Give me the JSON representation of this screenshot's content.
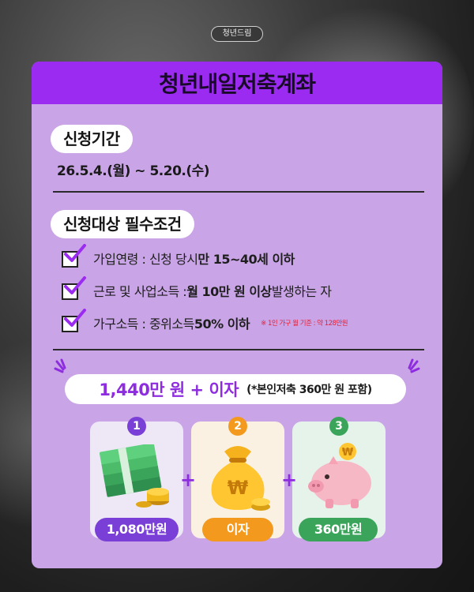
{
  "brand": "청년드림",
  "title": "청년내일저축계좌",
  "period": {
    "heading": "신청기간",
    "value": "26.5.4.(월) ~ 5.20.(수)"
  },
  "requirements": {
    "heading": "신청대상 필수조건",
    "items": [
      {
        "label": "가입연령 : 신청 당시 ",
        "strong": "만 15~40세 이하",
        "tail": ""
      },
      {
        "label": "근로 및 사업소득 : ",
        "strong": "월 10만 원 이상",
        "tail": " 발생하는 자"
      },
      {
        "label": "가구소득 : 중위소득 ",
        "strong": "50% 이하",
        "tail": "",
        "note": "※ 1인 가구 월 기준 : 약 128만원"
      }
    ]
  },
  "total": {
    "amount": "1,440만 원 + 이자",
    "note": "(*본인저축 360만 원 포함)"
  },
  "breakdown": [
    {
      "step": "1",
      "label": "1,080만원",
      "color": "#7a3fd6",
      "icon": "cash-stack-icon"
    },
    {
      "step": "2",
      "label": "이자",
      "color": "#f39a1e",
      "icon": "money-bag-icon"
    },
    {
      "step": "3",
      "label": "360만원",
      "color": "#3aa55a",
      "icon": "piggy-bank-icon"
    }
  ],
  "plus": "+",
  "colors": {
    "accent": "#9b2bf0",
    "card": "#c9a4e6",
    "note": "#e0223a"
  }
}
